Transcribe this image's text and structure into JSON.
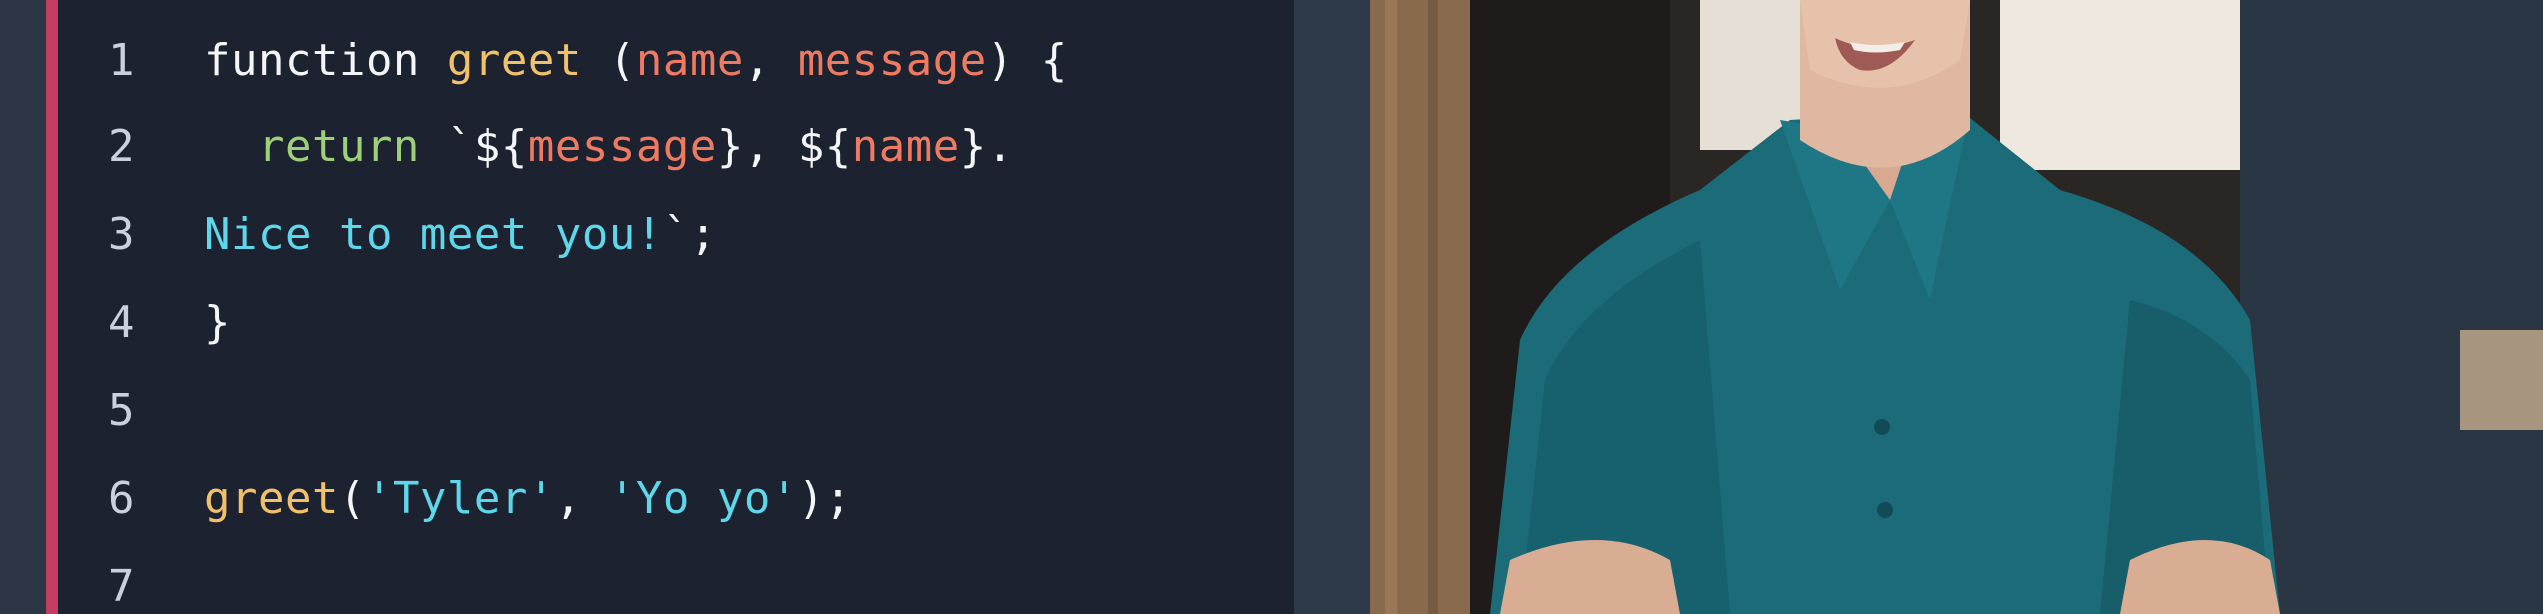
{
  "colors": {
    "accent": "#c53c63",
    "panel_bg": "#1c2230",
    "keyword": "#f4f5f7",
    "function_name": "#f1c06b",
    "parameter": "#ef7a62",
    "return": "#9ed07a",
    "string": "#5ed7ea"
  },
  "editor": {
    "lines": [
      {
        "number": "1",
        "tokens": [
          {
            "text": "function ",
            "kind": "kw"
          },
          {
            "text": "greet",
            "kind": "fn"
          },
          {
            "text": " (",
            "kind": "punc"
          },
          {
            "text": "name",
            "kind": "param"
          },
          {
            "text": ", ",
            "kind": "punc"
          },
          {
            "text": "message",
            "kind": "param"
          },
          {
            "text": ") {",
            "kind": "punc"
          }
        ]
      },
      {
        "number": "2",
        "tokens": [
          {
            "text": "  ",
            "kind": "punc"
          },
          {
            "text": "return",
            "kind": "ret"
          },
          {
            "text": " `${",
            "kind": "tpl"
          },
          {
            "text": "message",
            "kind": "param"
          },
          {
            "text": "}, ${",
            "kind": "tpl"
          },
          {
            "text": "name",
            "kind": "param"
          },
          {
            "text": "}.",
            "kind": "tpl"
          }
        ]
      },
      {
        "number": "3",
        "tokens": [
          {
            "text": "Nice to meet you!",
            "kind": "str"
          },
          {
            "text": "`;",
            "kind": "punc"
          }
        ]
      },
      {
        "number": "4",
        "tokens": [
          {
            "text": "}",
            "kind": "punc"
          }
        ]
      },
      {
        "number": "5",
        "tokens": []
      },
      {
        "number": "6",
        "tokens": [
          {
            "text": "greet",
            "kind": "fn"
          },
          {
            "text": "(",
            "kind": "punc"
          },
          {
            "text": "'Tyler'",
            "kind": "str"
          },
          {
            "text": ", ",
            "kind": "punc"
          },
          {
            "text": "'Yo yo'",
            "kind": "str"
          },
          {
            "text": ");",
            "kind": "punc"
          }
        ]
      },
      {
        "number": "7",
        "tokens": []
      }
    ]
  },
  "video": {
    "subject": "presenter-in-teal-polo"
  }
}
